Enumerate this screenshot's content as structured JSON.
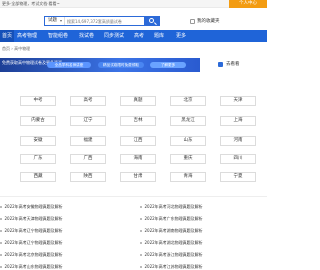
{
  "topbar": {
    "slogan": "更多·全部物理，考试文档·看看~",
    "login_label": "个人中心"
  },
  "search": {
    "scope_label": "试题",
    "placeholder": "搜索14,697,372套高质量试卷",
    "bookmark_label": "我的收藏夹"
  },
  "nav": {
    "items": [
      "首页",
      "高考物理",
      "智能组卷",
      "找试卷",
      "同步测试",
      "高考",
      "题库",
      "更多"
    ]
  },
  "breadcrumb": "首页 › 高中物理",
  "banner": {
    "text": "免费获取高中物理试卷及更多资源",
    "pill1": "全品学科名师讲座",
    "pill2": "精品试卷限时免费领取",
    "pill3": "了解更多",
    "side_link": "去看看"
  },
  "provinces": [
    [
      "中考",
      "高考",
      "真题",
      "北京",
      "天津"
    ],
    [
      "内蒙古",
      "辽宁",
      "吉林",
      "黑龙江",
      "上海"
    ],
    [
      "安徽",
      "福建",
      "江西",
      "山东",
      "河南"
    ],
    [
      "广东",
      "广西",
      "海南",
      "重庆",
      "四川"
    ],
    [
      "西藏",
      "陕西",
      "甘肃",
      "青海",
      "宁夏"
    ]
  ],
  "articles_left": [
    "2022年高考安徽物理真题及解析",
    "2022年高考天津物理真题及解析",
    "2022年高考辽宁物理真题及解析",
    "2022年高考辽宁物理真题及解析",
    "2022年高考北京物理真题及解析",
    "2022年高考山东物理真题及解析"
  ],
  "articles_right": [
    "2022年高考河北物理真题及解析",
    "2022年高考广东物理真题及解析",
    "2022年高考湖南物理真题及解析",
    "2022年高考湖北物理真题及解析",
    "2022年高考浙江物理真题及解析",
    "2022年高考江苏物理真题及解析"
  ],
  "colors": {
    "nav": "#1f64d8",
    "accent_orange": "#f39c12"
  }
}
